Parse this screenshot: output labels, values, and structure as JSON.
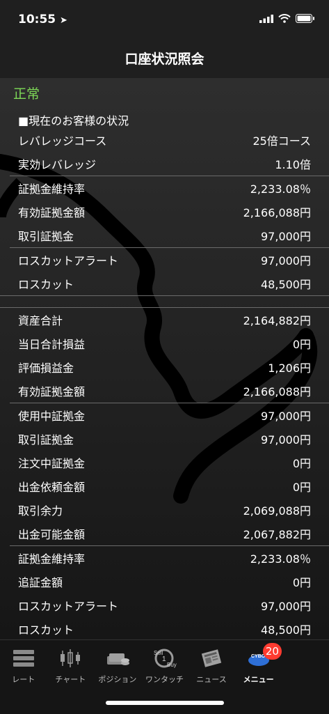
{
  "status_bar": {
    "time": "10:55"
  },
  "nav": {
    "title": "口座状況照会"
  },
  "account": {
    "status": "正常",
    "section_title": "■現在のお客様の状況"
  },
  "rows_group1": [
    {
      "label": "レバレッジコース",
      "value": "25倍コース"
    },
    {
      "label": "実効レバレッジ",
      "value": "1.10倍"
    }
  ],
  "rows_group2": [
    {
      "label": "証拠金維持率",
      "value": "2,233.08％"
    },
    {
      "label": "有効証拠金額",
      "value": "2,166,088円"
    },
    {
      "label": "取引証拠金",
      "value": "97,000円"
    }
  ],
  "rows_group3": [
    {
      "label": "ロスカットアラート",
      "value": "97,000円"
    },
    {
      "label": "ロスカット",
      "value": "48,500円"
    }
  ],
  "rows_group4": [
    {
      "label": "資産合計",
      "value": "2,164,882円"
    },
    {
      "label": "当日合計損益",
      "value": "0円"
    },
    {
      "label": "評価損益金",
      "value": "1,206円"
    },
    {
      "label": "有効証拠金額",
      "value": "2,166,088円"
    }
  ],
  "rows_group5": [
    {
      "label": "使用中証拠金",
      "value": "97,000円"
    },
    {
      "label": "取引証拠金",
      "value": "97,000円"
    },
    {
      "label": "注文中証拠金",
      "value": "0円"
    },
    {
      "label": "出金依頼金額",
      "value": "0円"
    },
    {
      "label": "取引余力",
      "value": "2,069,088円"
    },
    {
      "label": "出金可能金額",
      "value": "2,067,882円"
    }
  ],
  "rows_group6": [
    {
      "label": "証拠金維持率",
      "value": "2,233.08％"
    },
    {
      "label": "追証金額",
      "value": "0円"
    },
    {
      "label": "ロスカットアラート",
      "value": "97,000円"
    },
    {
      "label": "ロスカット",
      "value": "48,500円"
    }
  ],
  "tabbar": {
    "tabs": [
      {
        "label": "レート",
        "icon": "rate-icon"
      },
      {
        "label": "チャート",
        "icon": "chart-icon"
      },
      {
        "label": "ポジション",
        "icon": "position-icon"
      },
      {
        "label": "ワンタッチ",
        "icon": "one-touch-icon"
      },
      {
        "label": "ニュース",
        "icon": "news-icon"
      },
      {
        "label": "メニュー",
        "icon": "menu-icon",
        "badge": "20"
      }
    ],
    "menu_icon_text": "CYBO"
  },
  "colors": {
    "status_ok": "#7ed957",
    "badge": "#ff3b30"
  }
}
